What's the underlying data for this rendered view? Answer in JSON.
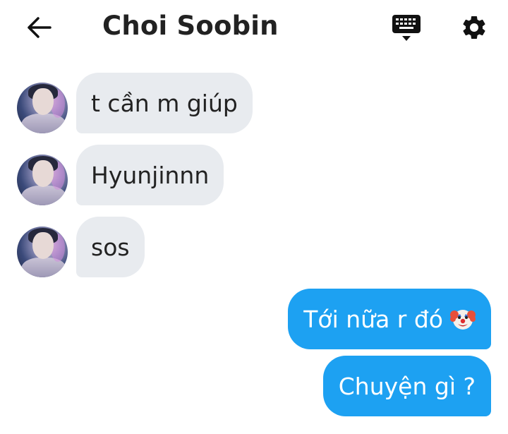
{
  "header": {
    "back_icon": "arrow-left-icon",
    "title": "Choi Soobin",
    "keyboard_icon": "keyboard-icon",
    "settings_icon": "gear-icon"
  },
  "messages": [
    {
      "direction": "incoming",
      "text": "t cần m giúp"
    },
    {
      "direction": "incoming",
      "text": "Hyunjinnn"
    },
    {
      "direction": "incoming",
      "text": "sos"
    },
    {
      "direction": "outgoing",
      "text": "Tới nữa r đó",
      "emoji": "clown-face-emoji"
    },
    {
      "direction": "outgoing",
      "text": "Chuyện gì ?"
    }
  ],
  "colors": {
    "incoming_bubble": "#e8ebef",
    "outgoing_bubble": "#1da1f2",
    "outgoing_text": "#ffffff",
    "text": "#222222"
  }
}
